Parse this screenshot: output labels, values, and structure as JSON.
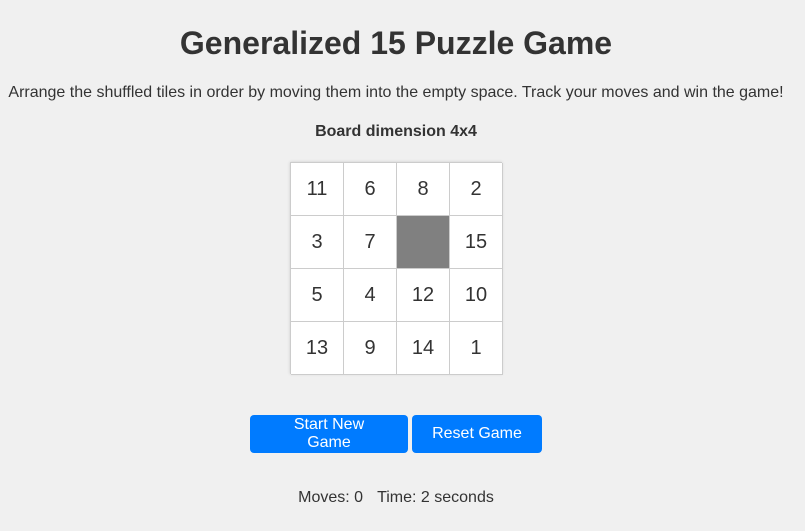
{
  "header": {
    "title": "Generalized 15 Puzzle Game",
    "description": "Arrange the shuffled tiles in order by moving them into the empty space. Track your moves and win the game!"
  },
  "board": {
    "dimension_label": "Board dimension 4x4",
    "tiles": [
      "11",
      "6",
      "8",
      "2",
      "3",
      "7",
      "",
      "15",
      "5",
      "4",
      "12",
      "10",
      "13",
      "9",
      "14",
      "1"
    ]
  },
  "controls": {
    "start_label": "Start New Game",
    "reset_label": "Reset Game"
  },
  "status": {
    "moves_label": "Moves: 0",
    "time_label": "Time: 2 seconds"
  },
  "colors": {
    "background": "#f0f0f0",
    "button": "#007bff",
    "empty_tile": "#808080",
    "text": "#333333"
  }
}
